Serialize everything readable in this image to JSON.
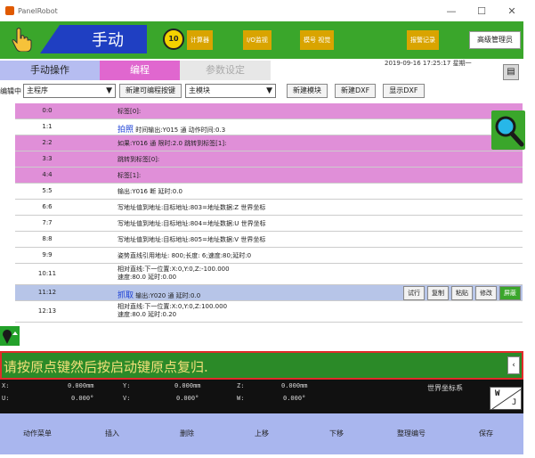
{
  "window": {
    "title": "PanelRobot",
    "minimize": "—",
    "maximize": "☐",
    "close": "✕"
  },
  "topbar": {
    "mode": "手动",
    "speed": "10",
    "buttons": [
      "计算器",
      "I/O监视",
      "模号 视觉",
      "报警记录"
    ],
    "admin": "高级管理员"
  },
  "tabs": [
    "手动操作",
    "编程",
    "参数设定"
  ],
  "datetime": "2019-09-16  17:25:17  星期一",
  "toolbar": {
    "label": "编辑中",
    "program": "主程序",
    "new_button_key": "新建可编程按键",
    "module": "主模块",
    "new_module": "新建模块",
    "new_dxf": "新建DXF",
    "show_dxf": "显示DXF"
  },
  "rows": [
    {
      "num": "0:0",
      "text": "标签[0]:",
      "style": "pink"
    },
    {
      "num": "1:1",
      "kw": "拍照",
      "text": " 时间输出:Y015 通 动作时间:0.3",
      "style": "white"
    },
    {
      "num": "2:2",
      "text": "如果:Y016 通 限时:2.0 跳转到标签[1]:",
      "style": "pink"
    },
    {
      "num": "3:3",
      "text": "跳转到标签[0]:",
      "style": "pink"
    },
    {
      "num": "4:4",
      "text": "标签[1]:",
      "style": "pink"
    },
    {
      "num": "5:5",
      "text": "输出:Y016 断 延时:0.0",
      "style": "white"
    },
    {
      "num": "6:6",
      "text": "写地址值到地址:目标地址:803=地址数据:Z 世界坐标",
      "style": "white"
    },
    {
      "num": "7:7",
      "text": "写地址值到地址:目标地址:804=地址数据:U 世界坐标",
      "style": "white"
    },
    {
      "num": "8:8",
      "text": "写地址值到地址:目标地址:805=地址数据:V 世界坐标",
      "style": "white"
    },
    {
      "num": "9:9",
      "text": "姿势直线引用地址: 800;长度: 6;速度:80;延时:0",
      "style": "white"
    },
    {
      "num": "10:11",
      "text": "相对直线:下一位置:X:0,Y:0,Z:-100.000",
      "text2": "速度:80.0 延时:0.00",
      "style": "white",
      "tall": true
    },
    {
      "num": "11:12",
      "kw": "抓取",
      "text": " 输出:Y020 通 延时:0.0",
      "style": "sel"
    },
    {
      "num": "12:13",
      "text": "相对直线:下一位置:X:0,Y:0,Z:100.000",
      "text2": "速度:80.0 延时:0.20",
      "style": "white",
      "tall": true
    }
  ],
  "row_actions": [
    "试行",
    "复制",
    "粘贴",
    "修改",
    "屏蔽"
  ],
  "message": "请按原点键然后按启动键原点复归.",
  "coords": [
    {
      "axis": "X:",
      "value": "0.000mm"
    },
    {
      "axis": "Y:",
      "value": "0.000mm"
    },
    {
      "axis": "Z:",
      "value": "0.000mm"
    },
    {
      "axis": "U:",
      "value": "0.000°"
    },
    {
      "axis": "V:",
      "value": "0.000°"
    },
    {
      "axis": "W:",
      "value": "0.000°"
    }
  ],
  "world_label": "世界坐标系",
  "coord_toggle": {
    "a": "W",
    "b": "J"
  },
  "bottom": [
    "动作菜单",
    "插入",
    "删除",
    "上移",
    "下移",
    "整理编号",
    "保存"
  ]
}
